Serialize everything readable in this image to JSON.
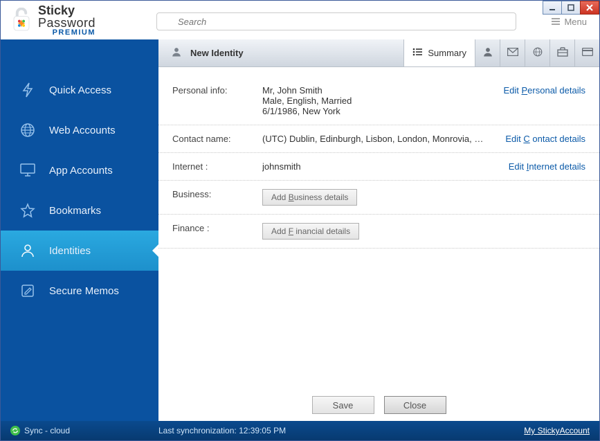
{
  "app": {
    "name1": "Sticky",
    "name2": "Password",
    "edition": "PREMIUM"
  },
  "search": {
    "placeholder": "Search"
  },
  "menu": {
    "label": "Menu"
  },
  "sidebar": {
    "items": [
      {
        "label": "Quick Access"
      },
      {
        "label": "Web Accounts"
      },
      {
        "label": "App Accounts"
      },
      {
        "label": "Bookmarks"
      },
      {
        "label": "Identities"
      },
      {
        "label": "Secure Memos"
      }
    ]
  },
  "header": {
    "title": "New Identity",
    "summary_label": "Summary"
  },
  "rows": {
    "personal": {
      "label": "Personal info:",
      "line1": "Mr, John  Smith",
      "line2": "Male, English, Married",
      "line3": "6/1/1986, New York",
      "edit_pre": "Edit ",
      "edit_u": "P",
      "edit_post": "ersonal details"
    },
    "contact": {
      "label": "Contact name:",
      "value": "(UTC) Dublin, Edinburgh, Lisbon, London, Monrovia, Reykjavik, Casablanca",
      "edit_pre": "Edit ",
      "edit_u": "C",
      "edit_post": " ontact details"
    },
    "internet": {
      "label": "Internet :",
      "value": "johnsmith",
      "edit_pre": "Edit ",
      "edit_u": "I",
      "edit_post": "nternet details"
    },
    "business": {
      "label": "Business:",
      "btn_pre": "Add ",
      "btn_u": "B",
      "btn_post": "usiness details"
    },
    "finance": {
      "label": "Finance :",
      "btn_pre": "Add ",
      "btn_u": "F",
      "btn_post": " inancial details"
    }
  },
  "buttons": {
    "save": "Save",
    "close": "Close"
  },
  "status": {
    "sync": "Sync - cloud",
    "last": "Last synchronization: 12:39:05 PM",
    "account": "My StickyAccount"
  }
}
